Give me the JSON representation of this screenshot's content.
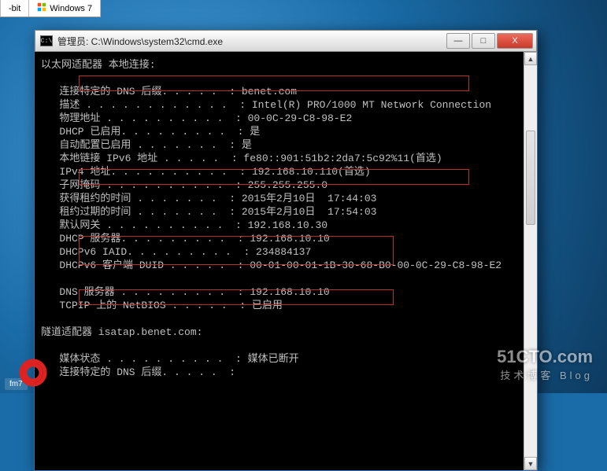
{
  "tabs": {
    "first": "-bit",
    "second": "Windows 7"
  },
  "taskbar_label": "fm7",
  "watermark": {
    "main": "51CTO.com",
    "sub": "技术博客    Blog"
  },
  "window": {
    "title": "管理员: C:\\Windows\\system32\\cmd.exe",
    "icon_text": "C:\\",
    "btn_min": "—",
    "btn_max": "□",
    "btn_close": "X"
  },
  "scroll": {
    "up": "▲",
    "down": "▼"
  },
  "ipconfig": {
    "adapter_header": "以太网适配器 本地连接:",
    "rows": [
      [
        "连接特定的 DNS 后缀",
        "benet.com"
      ],
      [
        "描述",
        "Intel(R) PRO/1000 MT Network Connection"
      ],
      [
        "物理地址",
        "00-0C-29-C8-98-E2"
      ],
      [
        "DHCP 已启用",
        "是"
      ],
      [
        "自动配置已启用",
        "是"
      ],
      [
        "本地链接 IPv6 地址",
        "fe80::901:51b2:2da7:5c92%11(首选)"
      ],
      [
        "IPv4 地址",
        "192.168.10.110(首选)"
      ],
      [
        "子网掩码",
        "255.255.255.0"
      ],
      [
        "获得租约的时间",
        "2015年2月10日  17:44:03"
      ],
      [
        "租约过期的时间",
        "2015年2月10日  17:54:03"
      ],
      [
        "默认网关",
        "192.168.10.30"
      ],
      [
        "DHCP 服务器",
        "192.168.10.10"
      ],
      [
        "DHCPv6 IAID",
        "234884137"
      ],
      [
        "DHCPv6 客户端 DUID",
        "00-01-00-01-1B-30-68-B0-00-0C-29-C8-98-E2"
      ],
      [
        "",
        ""
      ],
      [
        "DNS 服务器",
        "192.168.10.10"
      ],
      [
        "TCPIP 上的 NetBIOS",
        "已启用"
      ]
    ],
    "tunnel_header": "隧道适配器 isatap.benet.com:",
    "tunnel_rows": [
      [
        "媒体状态",
        "媒体已断开"
      ],
      [
        "连接特定的 DNS 后缀",
        ""
      ]
    ]
  }
}
